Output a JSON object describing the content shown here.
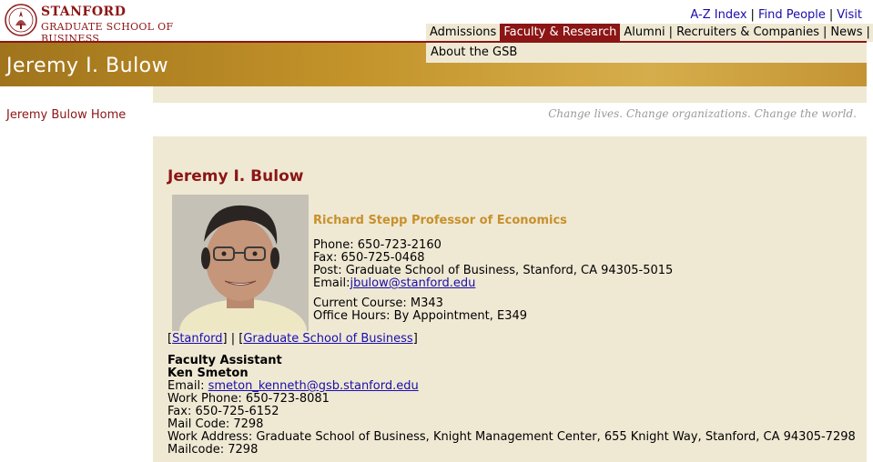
{
  "logo": {
    "line1": "STANFORD",
    "line2": "GRADUATE SCHOOL OF BUSINESS",
    "seal_icon": "stanford-seal-icon"
  },
  "utility": {
    "az_index": "A-Z Index",
    "find_people": "Find People",
    "visit": "Visit"
  },
  "nav": {
    "items": [
      {
        "label": "Admissions"
      },
      {
        "label": "Faculty & Research"
      },
      {
        "label": "Alumni"
      },
      {
        "label": "Recruiters & Companies"
      },
      {
        "label": "News"
      }
    ],
    "sub_item": "About the GSB",
    "active_color": "#8c1515"
  },
  "banner": {
    "title": "Jeremy I. Bulow"
  },
  "tagline": "Change lives. Change organizations. Change the world.",
  "leftnav": {
    "home_link": "Jeremy Bulow Home"
  },
  "faculty": {
    "name": "Jeremy I. Bulow",
    "title": "Richard Stepp Professor of Economics",
    "phone": "Phone: 650-723-2160",
    "fax": "Fax: 650-725-0468",
    "post": "Post: Graduate School of Business, Stanford, CA 94305-5015",
    "email_label": "Email:",
    "email": "jbulow@stanford.edu",
    "course": "Current Course: M343",
    "office_hours": "Office Hours: By Appointment, E349"
  },
  "links": {
    "stanford": "Stanford",
    "gsb": "Graduate School of Business"
  },
  "assistant": {
    "heading": "Faculty Assistant",
    "name": "Ken Smeton",
    "email_label": "Email:",
    "email": "smeton_kenneth@gsb.stanford.edu",
    "work_phone": "Work Phone: 650-723-8081",
    "fax": "Fax: 650-725-6152",
    "mail_code": "Mail Code: 7298",
    "work_address": "Work Address: Graduate School of Business, Knight Management Center, 655 Knight Way, Stanford, CA 94305-7298",
    "mailcode": "Mailcode: 7298"
  },
  "colors": {
    "cardinal": "#8c1515",
    "tan": "#efe9d4",
    "gold": "#c8902c"
  }
}
